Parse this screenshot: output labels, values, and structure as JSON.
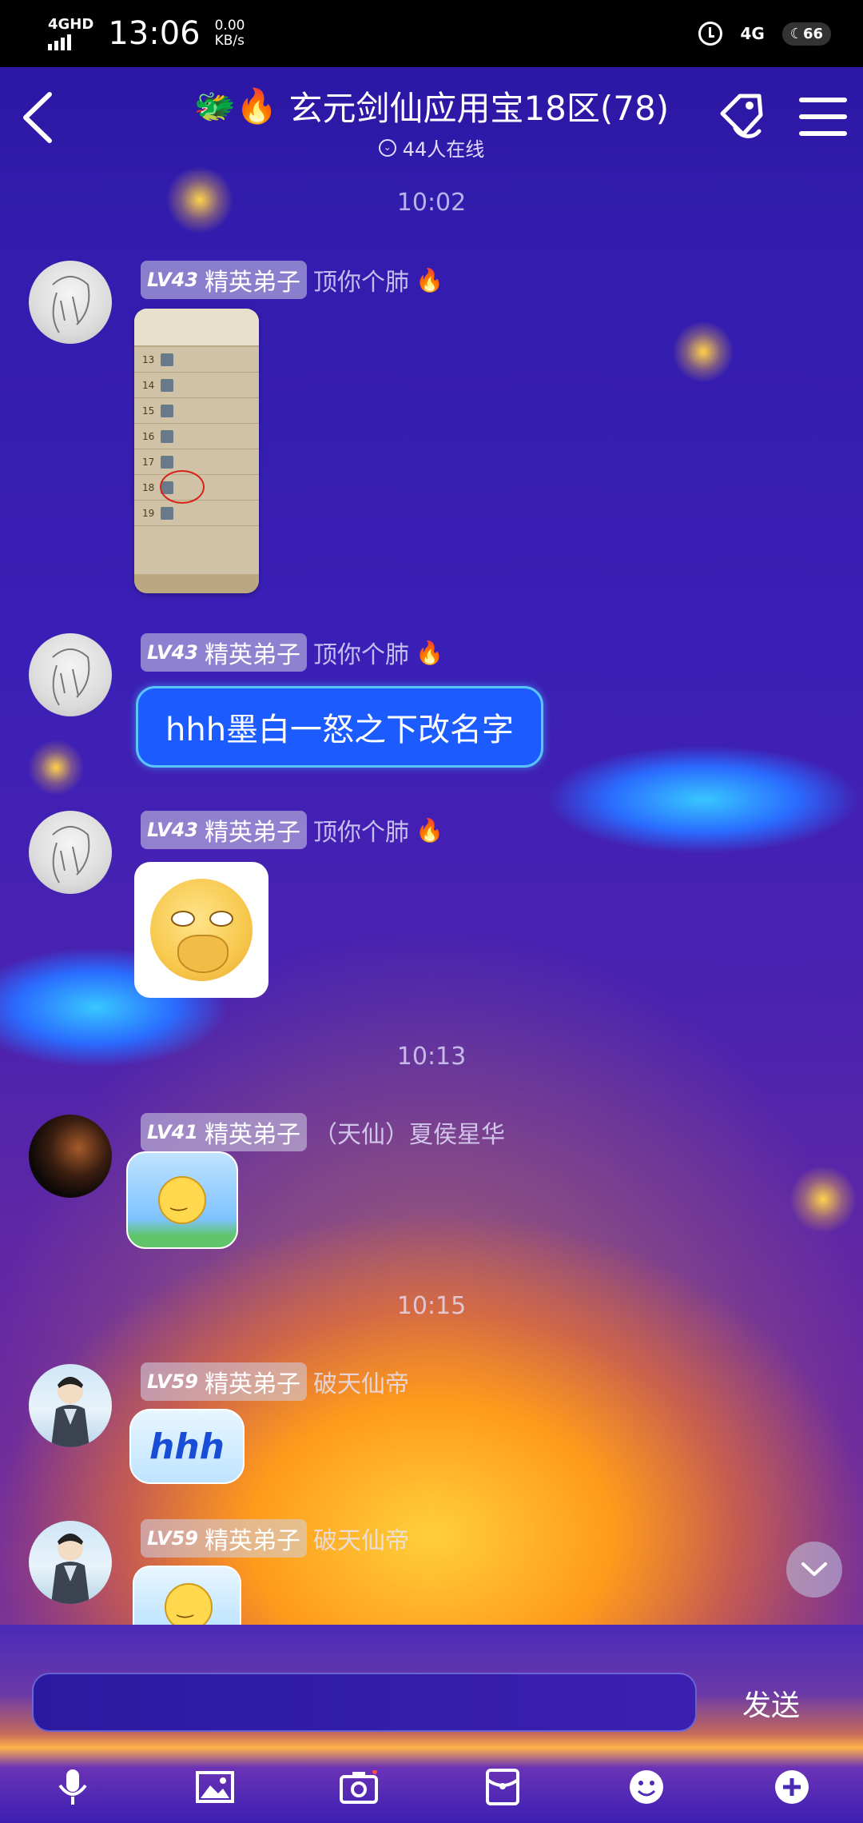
{
  "status_bar": {
    "network": "4GHD",
    "time": "13:06",
    "speed_value": "0.00",
    "speed_unit": "KB/s",
    "right_network": "4G",
    "battery_label": "66"
  },
  "header": {
    "title": "玄元剑仙应用宝18区(78)",
    "title_emoji": "🐲🔥",
    "online": "44人在线"
  },
  "messages": [
    {
      "time": "10:02"
    },
    {
      "lv": "LV43",
      "rank": "精英弟子",
      "name": "顶你个肺",
      "name_emoji": "🔥",
      "type": "image"
    },
    {
      "lv": "LV43",
      "rank": "精英弟子",
      "name": "顶你个肺",
      "name_emoji": "🔥",
      "type": "text",
      "text": "hhh墨白一怒之下改名字"
    },
    {
      "lv": "LV43",
      "rank": "精英弟子",
      "name": "顶你个肺",
      "name_emoji": "🔥",
      "type": "sticker"
    },
    {
      "time": "10:13"
    },
    {
      "lv": "LV41",
      "rank": "精英弟子",
      "name": "（天仙）夏侯星华",
      "type": "sticker"
    },
    {
      "time": "10:15"
    },
    {
      "lv": "LV59",
      "rank": "精英弟子",
      "name": "破天仙帝",
      "type": "sticker",
      "sticker_text": "hhh"
    },
    {
      "lv": "LV59",
      "rank": "精英弟子",
      "name": "破天仙帝",
      "type": "sticker"
    }
  ],
  "ranking_image": {
    "rows": [
      "13",
      "14",
      "15",
      "16",
      "17",
      "18",
      "19"
    ]
  },
  "input": {
    "send_label": "发送"
  },
  "toolbar": [
    "mic-icon",
    "image-icon",
    "camera-icon",
    "red-packet-icon",
    "emoji-icon",
    "plus-icon"
  ],
  "colors": {
    "bubble": "#1c5cff",
    "bubble_border": "#5ac4ff",
    "status_bar": "#000000"
  }
}
